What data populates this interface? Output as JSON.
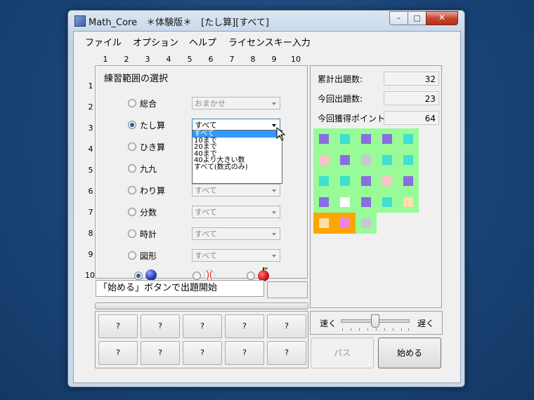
{
  "window": {
    "title": "Math_Core　＊体験版＊　[たし算][すべて]",
    "min": "–",
    "max": "□",
    "close": "✕"
  },
  "menu": [
    "ファイル",
    "オプション",
    "ヘルプ",
    "ライセンスキー入力"
  ],
  "columns": [
    "1",
    "2",
    "3",
    "4",
    "5",
    "6",
    "7",
    "8",
    "9",
    "10"
  ],
  "rows": [
    "1",
    "2",
    "3",
    "4",
    "5",
    "6",
    "7",
    "8",
    "9",
    "10"
  ],
  "section_title": "練習範囲の選択",
  "options": [
    {
      "label": "総合",
      "combo": "おまかせ",
      "checked": false,
      "active": false
    },
    {
      "label": "たし算",
      "combo": "すべて",
      "checked": true,
      "active": true
    },
    {
      "label": "ひき算",
      "combo": "",
      "checked": false,
      "active": false
    },
    {
      "label": "九九",
      "combo": "",
      "checked": false,
      "active": false
    },
    {
      "label": "わり算",
      "combo": "すべて",
      "checked": false,
      "active": false
    },
    {
      "label": "分数",
      "combo": "すべて",
      "checked": false,
      "active": false
    },
    {
      "label": "時計",
      "combo": "すべて",
      "checked": false,
      "active": false
    },
    {
      "label": "図形",
      "combo": "すべて",
      "checked": false,
      "active": false
    }
  ],
  "dropdown": {
    "items": [
      "すべて",
      "10まで",
      "20まで",
      "40まで",
      "40より大きい数",
      "すべて(数式のみ)"
    ],
    "selected": 0
  },
  "themes": [
    {
      "icon": "blue-ball-icon",
      "checked": true
    },
    {
      "icon": "baseball-icon",
      "checked": false
    },
    {
      "icon": "apple-icon",
      "checked": false
    }
  ],
  "status_message": "「始める」ボタンで出題開始",
  "question_buttons": [
    "?",
    "?",
    "?",
    "?",
    "?",
    "?",
    "?",
    "?",
    "?",
    "?"
  ],
  "stats": [
    {
      "label": "累計出題数:",
      "value": "32"
    },
    {
      "label": "今回出題数:",
      "value": "23"
    },
    {
      "label": "今回獲得ポイント:",
      "value": "64"
    }
  ],
  "tiles": [
    [
      "#8a6ee0",
      "#40e0d0",
      "#8a6ee0",
      "#8a6ee0",
      "#40e0d0"
    ],
    [
      "#ffc0cb",
      "#8a6ee0",
      "#c8c8d0",
      "#40e0d0",
      "#40e0d0"
    ],
    [
      "#40e0d0",
      "#40e0d0",
      "#8a6ee0",
      "#ffc0cb",
      "#8a6ee0"
    ],
    [
      "#8a6ee0",
      "#ffffff",
      "#8a6ee0",
      "#40e0d0",
      "#ffdead"
    ],
    [
      "#ffdead",
      "#ee82ee",
      "#c8c8d0"
    ]
  ],
  "tile_colors": {
    "board": "#98fb98",
    "highlight": "#ffa500"
  },
  "speed": {
    "fast_label": "速く",
    "slow_label": "遅く",
    "value": 0.5
  },
  "buttons": {
    "pass": "パス",
    "start": "始める"
  }
}
